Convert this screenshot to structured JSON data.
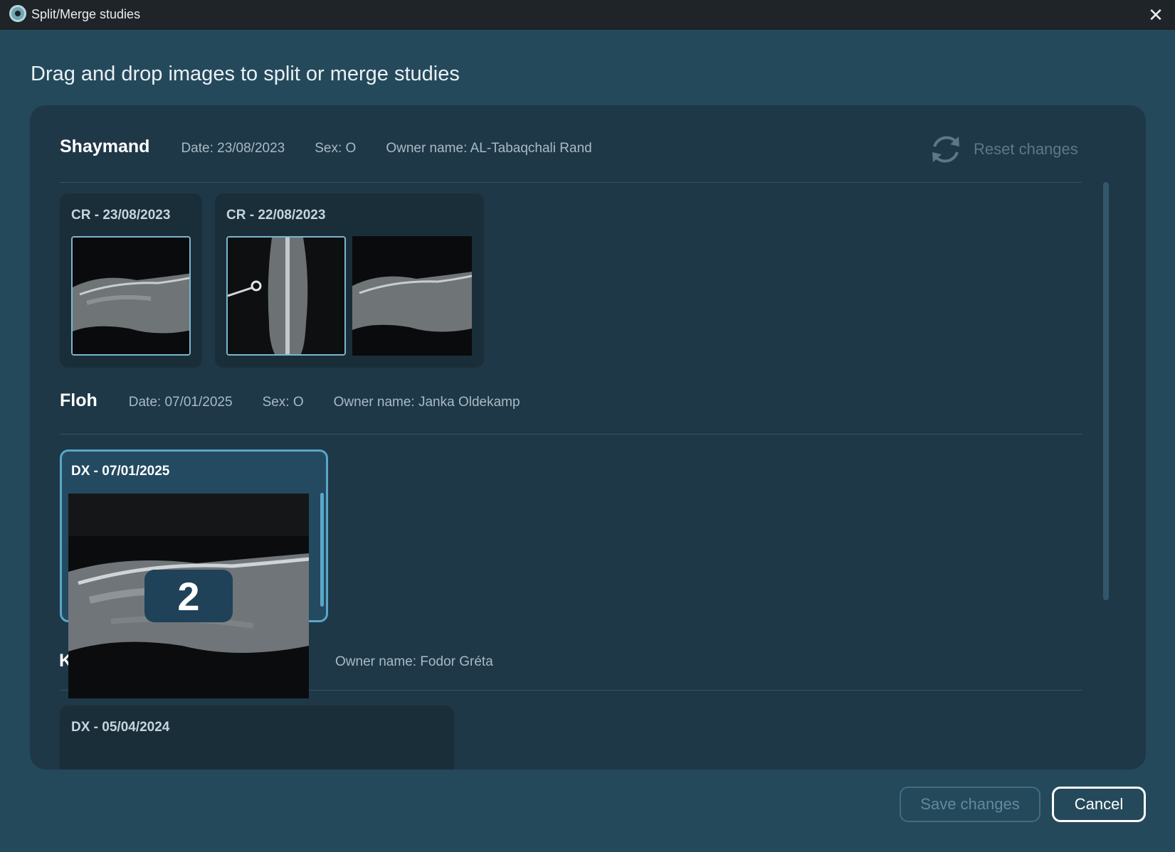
{
  "window": {
    "title": "Split/Merge studies",
    "close_glyph": "✕"
  },
  "heading": "Drag and drop images to split or merge studies",
  "reset_label": "Reset changes",
  "patients": [
    {
      "name": "Shaymand",
      "date": "Date: 23/08/2023",
      "sex": "Sex: O",
      "owner": "Owner name: AL-Tabaqchali Rand",
      "studies": [
        {
          "title": "CR - 23/08/2023",
          "images": 1
        },
        {
          "title": "CR - 22/08/2023",
          "images": 2
        }
      ]
    },
    {
      "name": "Floh",
      "date": "Date: 07/01/2025",
      "sex": "Sex: O",
      "owner": "Owner name: Janka Oldekamp",
      "studies": [
        {
          "title": "DX - 07/01/2025"
        }
      ]
    },
    {
      "name_peek": "K",
      "owner": "Owner name: Fodor Gréta",
      "studies": [
        {
          "title": "DX - 05/04/2024"
        }
      ]
    }
  ],
  "drag": {
    "count": "2"
  },
  "buttons": {
    "save": "Save changes",
    "cancel": "Cancel"
  },
  "icons": {
    "reset": "refresh-icon",
    "close": "close-icon",
    "app": "app-logo-icon"
  },
  "colors": {
    "background": "#24495b",
    "panel": "#1e3848",
    "accent": "#5aa6c8"
  }
}
